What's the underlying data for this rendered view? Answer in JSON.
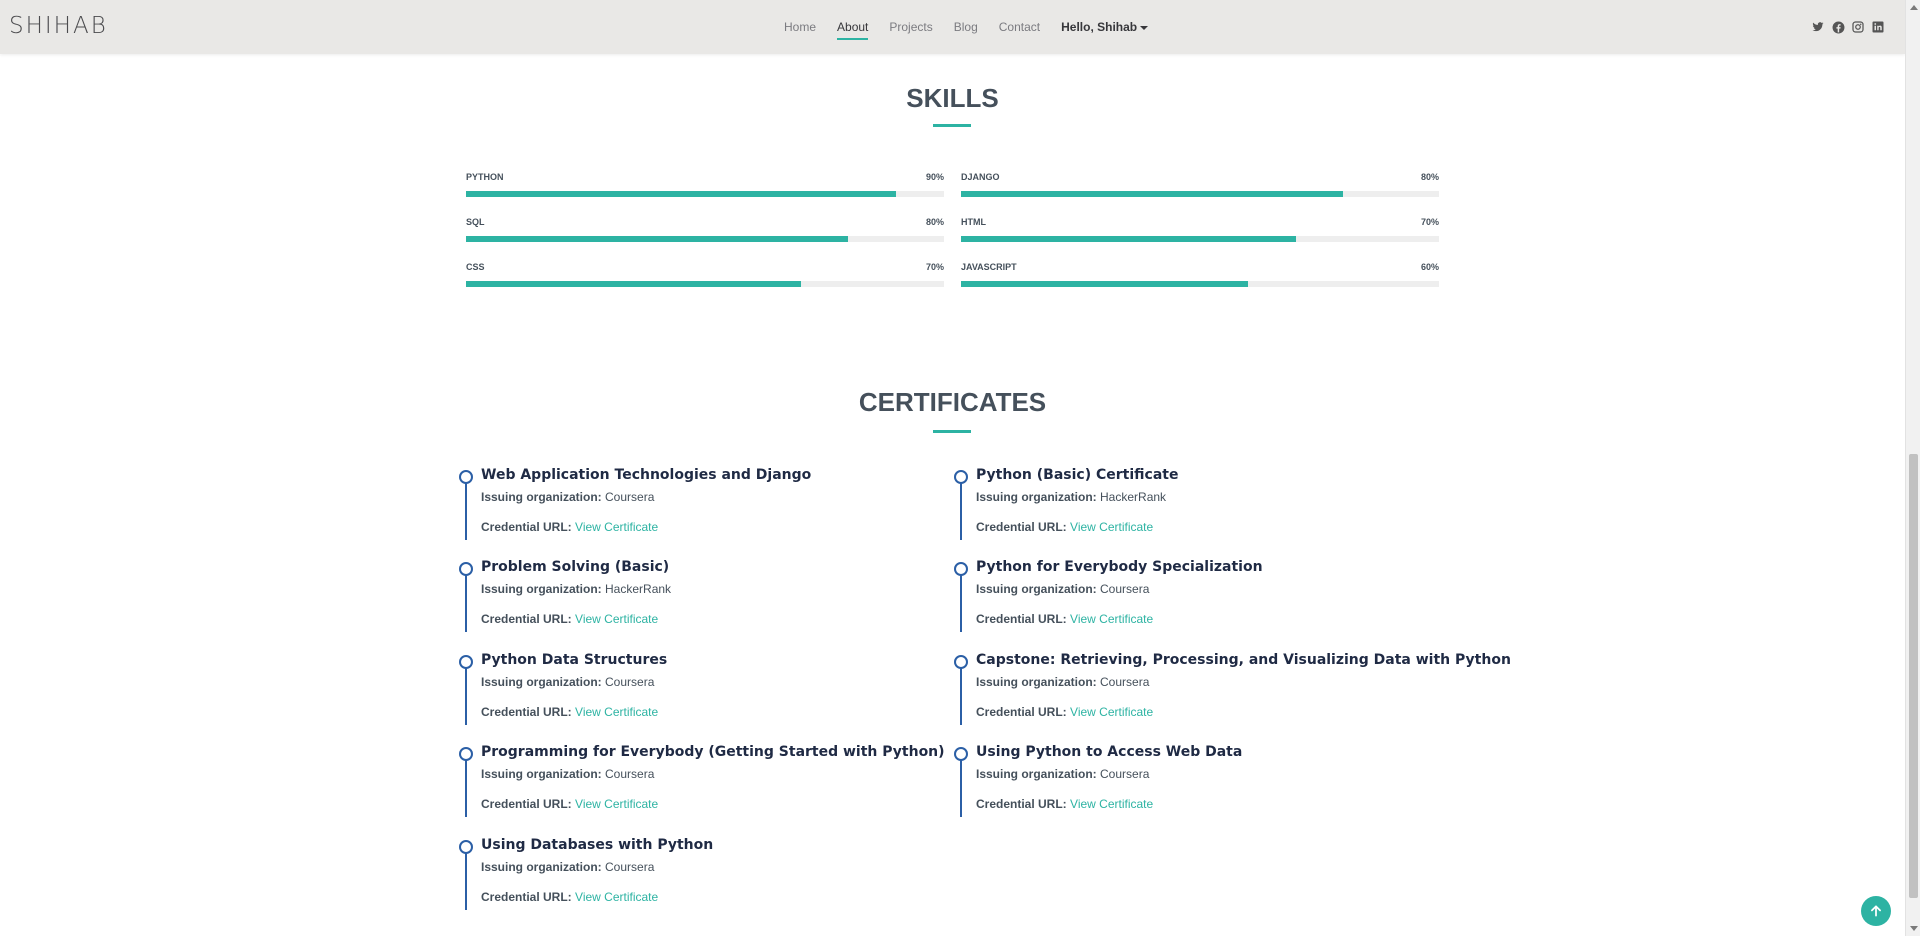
{
  "brand": "SHIHAB",
  "nav": {
    "home": "Home",
    "about": "About",
    "projects": "Projects",
    "blog": "Blog",
    "contact": "Contact",
    "user": "Hello, Shihab"
  },
  "social": [
    "twitter-icon",
    "facebook-icon",
    "instagram-icon",
    "linkedin-icon"
  ],
  "skills": {
    "title": "SKILLS",
    "items": [
      {
        "name": "PYTHON",
        "label": "90%",
        "value": 0.9
      },
      {
        "name": "DJANGO",
        "label": "80%",
        "value": 0.8
      },
      {
        "name": "SQL",
        "label": "80%",
        "value": 0.8
      },
      {
        "name": "HTML",
        "label": "70%",
        "value": 0.7
      },
      {
        "name": "CSS",
        "label": "70%",
        "value": 0.7
      },
      {
        "name": "JAVASCRIPT",
        "label": "60%",
        "value": 0.6
      }
    ]
  },
  "certificates": {
    "title": "CERTIFICATES",
    "org_label": "Issuing organization:",
    "url_label": "Credential URL:",
    "link_text": "View Certificate",
    "items": [
      {
        "title": "Web Application Technologies and Django",
        "org": "Coursera"
      },
      {
        "title": "Python (Basic) Certificate",
        "org": "HackerRank"
      },
      {
        "title": "Problem Solving (Basic)",
        "org": "HackerRank"
      },
      {
        "title": "Python for Everybody Specialization",
        "org": "Coursera"
      },
      {
        "title": "Python Data Structures",
        "org": "Coursera"
      },
      {
        "title": "Capstone: Retrieving, Processing, and Visualizing Data with Python",
        "org": "Coursera"
      },
      {
        "title": "Programming for Everybody (Getting Started with Python)",
        "org": "Coursera"
      },
      {
        "title": "Using Python to Access Web Data",
        "org": "Coursera"
      },
      {
        "title": "Using Databases with Python",
        "org": "Coursera"
      }
    ]
  },
  "colors": {
    "accent": "#2db3a3",
    "timeline": "#2b5fa6",
    "header_bg": "#e9e8e6"
  }
}
